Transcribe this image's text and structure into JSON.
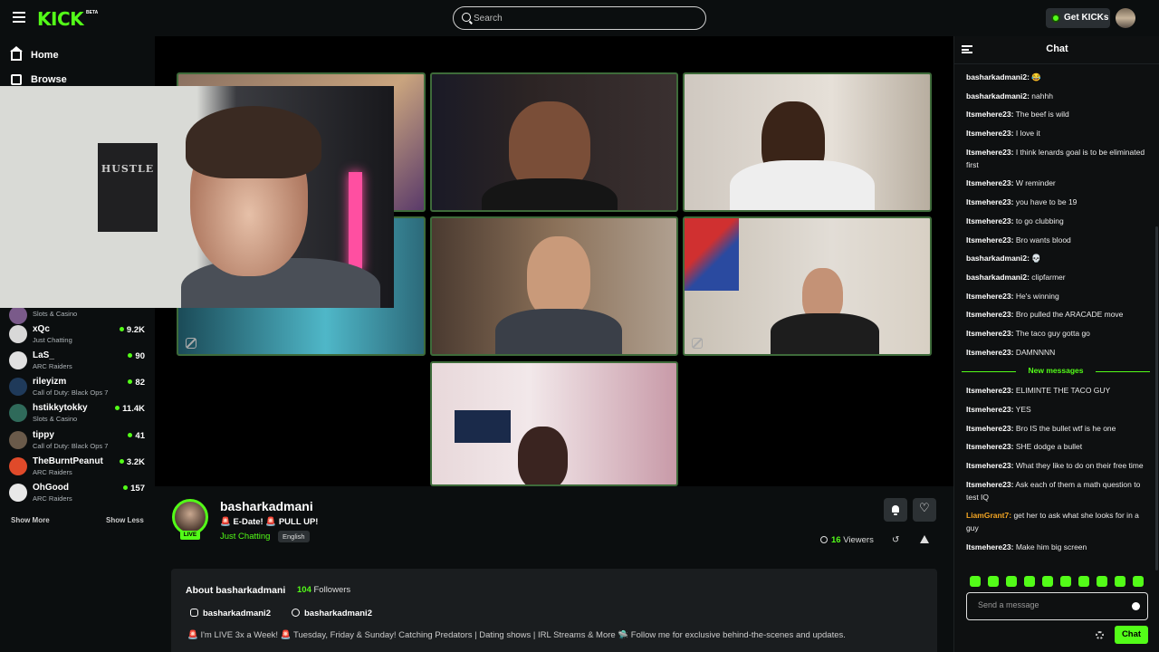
{
  "header": {
    "logo": "KICK",
    "logo_badge": "BETA",
    "search_placeholder": "Search",
    "get_kicks_label": "Get KICKs"
  },
  "sidebar": {
    "nav": [
      {
        "label": "Home",
        "icon": "home-icon"
      },
      {
        "label": "Browse",
        "icon": "browse-icon"
      }
    ],
    "streams": [
      {
        "name": "",
        "category": "Slots & Casino",
        "viewers": "",
        "color": "#7a5a8a"
      },
      {
        "name": "xQc",
        "category": "Just Chatting",
        "viewers": "9.2K",
        "color": "#d8d8d8"
      },
      {
        "name": "LaS_",
        "category": "ARC Raiders",
        "viewers": "90",
        "color": "#e0e0e0"
      },
      {
        "name": "rileyizm",
        "category": "Call of Duty: Black Ops 7",
        "viewers": "82",
        "color": "#1f3a5a"
      },
      {
        "name": "hstikkytokky",
        "category": "Slots & Casino",
        "viewers": "11.4K",
        "color": "#2f6a5a"
      },
      {
        "name": "tippy",
        "category": "Call of Duty: Black Ops 7",
        "viewers": "41",
        "color": "#6a5a4a"
      },
      {
        "name": "TheBurntPeanut",
        "category": "ARC Raiders",
        "viewers": "3.2K",
        "color": "#e04a2a"
      },
      {
        "name": "OhGood",
        "category": "ARC Raiders",
        "viewers": "157",
        "color": "#e8e8e8"
      }
    ],
    "show_more": "Show More",
    "show_less": "Show Less"
  },
  "video": {
    "pip_poster_text": "HUSTLE"
  },
  "stream": {
    "streamer": "basharkadmani",
    "live_label": "LIVE",
    "title": "🚨 E-Date! 🚨 PULL UP!",
    "category": "Just Chatting",
    "language": "English",
    "viewer_count": "16",
    "viewer_label": "Viewers"
  },
  "about": {
    "title": "About basharkadmani",
    "follower_count": "104",
    "follower_label": "Followers",
    "instagram": "basharkadmani2",
    "tiktok": "basharkadmani2",
    "description": "🚨 I'm LIVE 3x a Week! 🚨 Tuesday, Friday & Sunday! Catching Predators | Dating shows | IRL Streams & More 🛸 Follow me for exclusive behind-the-scenes and updates."
  },
  "chat": {
    "title": "Chat",
    "new_messages_label": "New messages",
    "messages_before": [
      {
        "user": "basharkadmani2:",
        "text": "😂",
        "color": "#ffffff"
      },
      {
        "user": "basharkadmani2:",
        "text": "nahhh",
        "color": "#ffffff"
      },
      {
        "user": "Itsmehere23:",
        "text": "The beef is wild",
        "color": "#ffffff"
      },
      {
        "user": "Itsmehere23:",
        "text": "I love it",
        "color": "#ffffff"
      },
      {
        "user": "Itsmehere23:",
        "text": "I think lenards goal is to be eliminated first",
        "color": "#ffffff"
      },
      {
        "user": "Itsmehere23:",
        "text": "W reminder",
        "color": "#ffffff"
      },
      {
        "user": "Itsmehere23:",
        "text": "you have to be 19",
        "color": "#ffffff"
      },
      {
        "user": "Itsmehere23:",
        "text": "to go clubbing",
        "color": "#ffffff"
      },
      {
        "user": "Itsmehere23:",
        "text": "Bro wants blood",
        "color": "#ffffff"
      },
      {
        "user": "basharkadmani2:",
        "text": "💀",
        "color": "#ffffff"
      },
      {
        "user": "basharkadmani2:",
        "text": "clipfarmer",
        "color": "#ffffff"
      },
      {
        "user": "Itsmehere23:",
        "text": "He's winning",
        "color": "#ffffff"
      },
      {
        "user": "Itsmehere23:",
        "text": "Bro pulled the ARACADE move",
        "color": "#ffffff"
      },
      {
        "user": "Itsmehere23:",
        "text": "The taco guy gotta go",
        "color": "#ffffff"
      },
      {
        "user": "Itsmehere23:",
        "text": "DAMNNNN",
        "color": "#ffffff"
      }
    ],
    "messages_after": [
      {
        "user": "Itsmehere23:",
        "text": "ELIMINTE THE TACO GUY",
        "color": "#ffffff"
      },
      {
        "user": "Itsmehere23:",
        "text": "YES",
        "color": "#ffffff"
      },
      {
        "user": "Itsmehere23:",
        "text": "Bro IS the bullet wtf is he one",
        "color": "#ffffff"
      },
      {
        "user": "Itsmehere23:",
        "text": "SHE dodge a bullet",
        "color": "#ffffff"
      },
      {
        "user": "Itsmehere23:",
        "text": "What they like to do on their free time",
        "color": "#ffffff"
      },
      {
        "user": "Itsmehere23:",
        "text": "Ask each of them a math question to test IQ",
        "color": "#ffffff"
      },
      {
        "user": "LiamGrant7:",
        "text": "get her to ask what she looks for in a guy",
        "color": "#f5a623"
      },
      {
        "user": "Itsmehere23:",
        "text": "Make him big screen",
        "color": "#ffffff"
      }
    ],
    "input_placeholder": "Send a message",
    "send_label": "Chat"
  },
  "colors": {
    "accent": "#53fc18",
    "background": "#0b0e0f",
    "panel": "#1a1d1f"
  }
}
